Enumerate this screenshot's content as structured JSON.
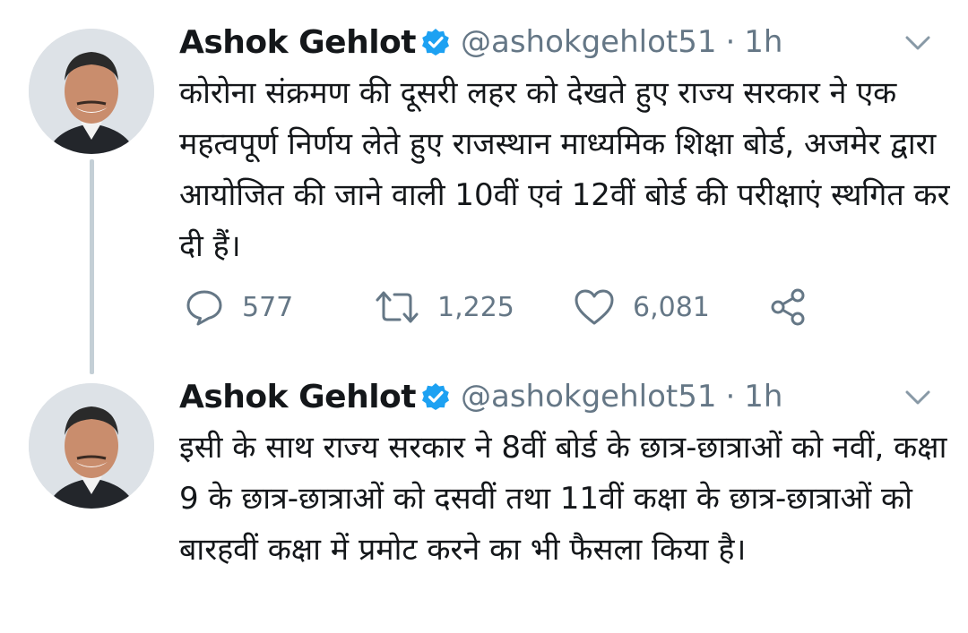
{
  "tweets": [
    {
      "author_name": "Ashok Gehlot",
      "handle": "@ashokgehlot51",
      "separator": "·",
      "time": "1h",
      "text": "कोरोना संक्रमण की दूसरी लहर को देखते हुए राज्य सरकार ने एक महत्वपूर्ण निर्णय लेते हुए राजस्थान माध्यमिक शिक्षा बोर्ड, अजमेर द्वारा आयोजित की जाने वाली 10वीं एवं 12वीं बोर्ड की परीक्षाएं स्थगित कर दी हैं।",
      "replies": "577",
      "retweets": "1,225",
      "likes": "6,081"
    },
    {
      "author_name": "Ashok Gehlot",
      "handle": "@ashokgehlot51",
      "separator": "·",
      "time": "1h",
      "text": "इसी के साथ राज्य सरकार ने 8वीं बोर्ड के छात्र-छात्राओं को नवीं, कक्षा 9 के छात्र-छात्राओं को दसवीं तथा 11वीं कक्षा के छात्र-छात्राओं को बारहवीं कक्षा में प्रमोट करने का भी फैसला किया है।"
    }
  ],
  "icons": {
    "verified": "verified-badge-icon",
    "menu": "chevron-down-icon",
    "reply": "reply-icon",
    "retweet": "retweet-icon",
    "like": "heart-icon",
    "share": "share-icon"
  },
  "colors": {
    "text": "#14171a",
    "secondary": "#657786",
    "verified": "#1da1f2",
    "thread_line": "#c4cfd6"
  }
}
